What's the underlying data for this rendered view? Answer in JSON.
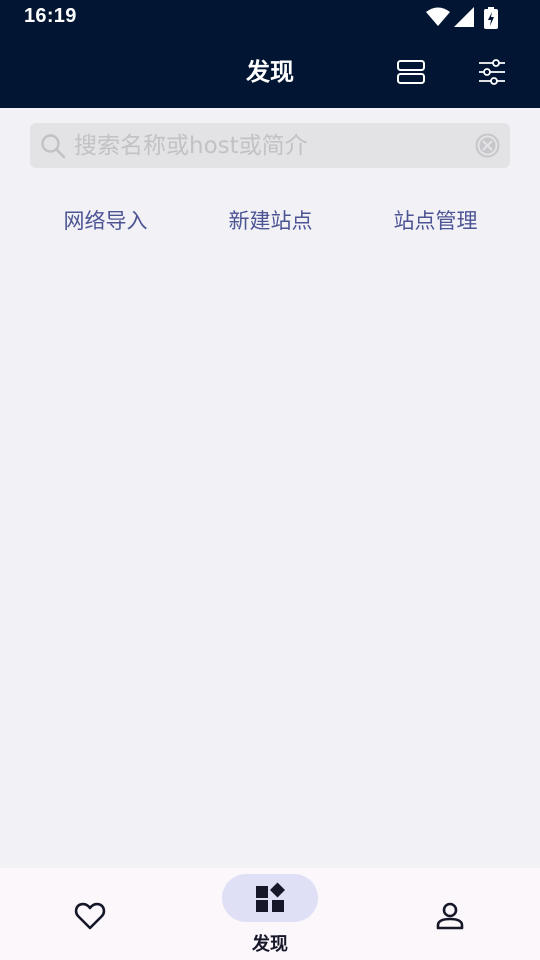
{
  "status_bar": {
    "time": "16:19",
    "icons": [
      "wifi-icon",
      "signal-icon",
      "battery-charging-icon"
    ]
  },
  "app_bar": {
    "title": "发现",
    "actions": [
      "layout-toggle-icon",
      "filter-sliders-icon"
    ],
    "background_color": "#021633"
  },
  "search": {
    "placeholder": "搜索名称或host或简介",
    "value": ""
  },
  "actions": [
    {
      "label": "网络导入"
    },
    {
      "label": "新建站点"
    },
    {
      "label": "站点管理"
    }
  ],
  "bottom_nav": {
    "items": [
      {
        "icon": "heart-icon",
        "label": "",
        "active": false
      },
      {
        "icon": "widgets-icon",
        "label": "发现",
        "active": true
      },
      {
        "icon": "person-icon",
        "label": "",
        "active": false
      }
    ]
  },
  "colors": {
    "accent_text": "#4d5494",
    "active_pill": "#dfe0f5",
    "page_background": "#f1f1f6"
  }
}
